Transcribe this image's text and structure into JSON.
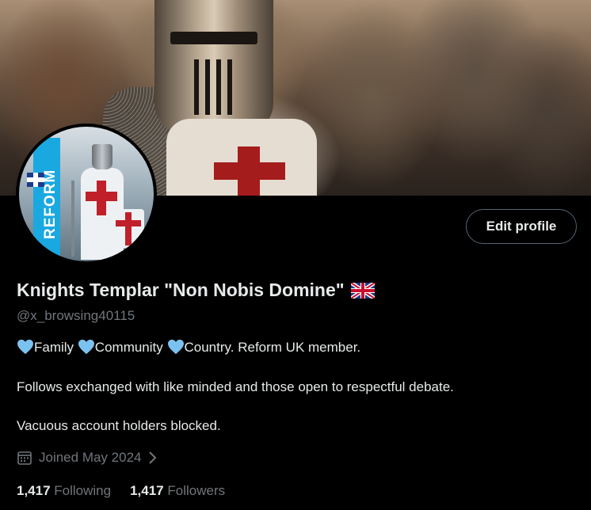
{
  "profile": {
    "display_name": "Knights Templar \"Non Nobis Domine\"",
    "flag_icon": "uk-flag-icon",
    "handle": "@x_browsing40115",
    "avatar_text": "REFORM",
    "edit_button": "Edit profile",
    "bio": {
      "segments": [
        "Family",
        "Community",
        "Country. Reform UK member."
      ],
      "heart_color": "#7cc2f0",
      "line2": "Follows exchanged with like minded and those open to respectful debate.",
      "line3": "Vacuous account holders blocked."
    },
    "joined": "Joined May 2024",
    "following_count": "1,417",
    "following_label": "Following",
    "followers_count": "1,417",
    "followers_label": "Followers"
  },
  "colors": {
    "background": "#000000",
    "text_primary": "#e7e9ea",
    "text_secondary": "#71767b",
    "button_border": "#536471"
  }
}
